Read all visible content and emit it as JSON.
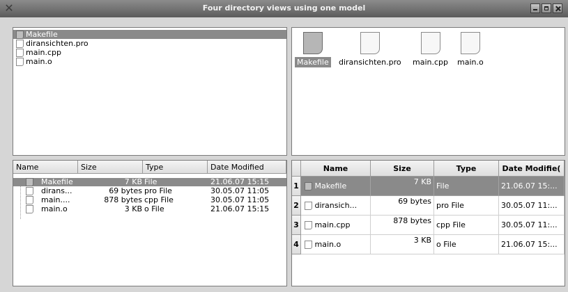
{
  "window": {
    "title": "Four directory views using one model"
  },
  "files": [
    {
      "name": "Makefile",
      "size": "7 KB",
      "type": "File",
      "date": "21.06.07 15:15"
    },
    {
      "name": "diransichten.pro",
      "size": "69 bytes",
      "type": "pro File",
      "date": "30.05.07 11:05"
    },
    {
      "name": "main.cpp",
      "size": "878 bytes",
      "type": "cpp File",
      "date": "30.05.07 11:05"
    },
    {
      "name": "main.o",
      "size": "3 KB",
      "type": "o File",
      "date": "21.06.07 15:15"
    }
  ],
  "tree": {
    "headers": [
      "Name",
      "Size",
      "Type",
      "Date Modified"
    ],
    "rows": [
      {
        "name": "Makefile",
        "size": "7 KB",
        "type": "File",
        "date": "21.06.07 15:15"
      },
      {
        "name": "dirans...",
        "size": "69 bytes",
        "type": "pro File",
        "date": "30.05.07 11:05"
      },
      {
        "name": "main....",
        "size": "878 bytes",
        "type": "cpp File",
        "date": "30.05.07 11:05"
      },
      {
        "name": "main.o",
        "size": "3 KB",
        "type": "o File",
        "date": "21.06.07 15:15"
      }
    ]
  },
  "table": {
    "headers": [
      "Name",
      "Size",
      "Type",
      "Date Modified"
    ],
    "header_visible": [
      "Name",
      "Size",
      "Type",
      "Date Modifie("
    ],
    "rows": [
      {
        "num": "1",
        "name": "Makefile",
        "size": "7 KB",
        "type": "File",
        "date": "21.06.07 15:..."
      },
      {
        "num": "2",
        "name": "diransich...",
        "size": "69 bytes",
        "type": "pro File",
        "date": "30.05.07 11:..."
      },
      {
        "num": "3",
        "name": "main.cpp",
        "size": "878 bytes",
        "type": "cpp File",
        "date": "30.05.07 11:..."
      },
      {
        "num": "4",
        "name": "main.o",
        "size": "3 KB",
        "type": "o File",
        "date": "21.06.07 15:..."
      }
    ]
  },
  "selection": {
    "selected_index": 0,
    "highlight_color": "#8a8a8a"
  },
  "icons": {
    "file": "file-icon",
    "close": "close-icon",
    "minimize": "minimize-icon",
    "maximize": "maximize-icon"
  }
}
